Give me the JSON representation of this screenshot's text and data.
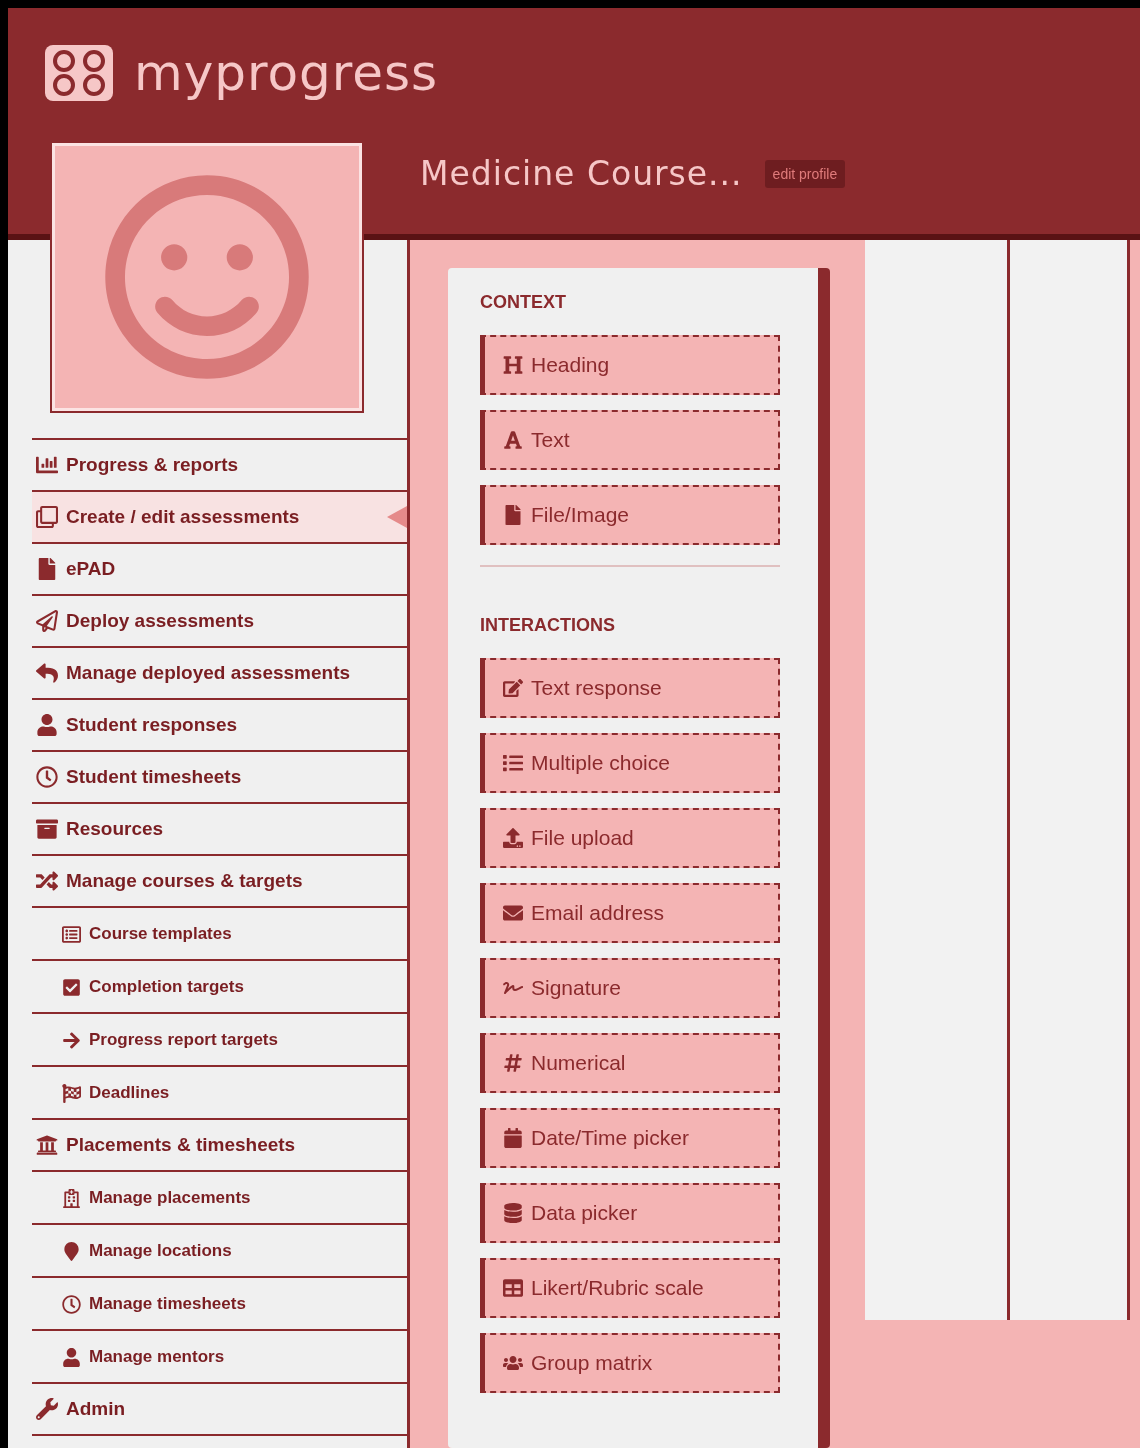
{
  "header": {
    "logo": "myprogress",
    "course_title": "Medicine Course...",
    "edit_button": "edit profile"
  },
  "sidebar": {
    "items": [
      {
        "label": "Progress & reports",
        "kind": "top",
        "selected": false
      },
      {
        "label": "Create / edit assessments",
        "kind": "top",
        "selected": true
      },
      {
        "label": "ePAD",
        "kind": "top",
        "selected": false
      },
      {
        "label": "Deploy assessments",
        "kind": "top",
        "selected": false
      },
      {
        "label": "Manage deployed assessments",
        "kind": "top",
        "selected": false
      },
      {
        "label": "Student responses",
        "kind": "top",
        "selected": false
      },
      {
        "label": "Student timesheets",
        "kind": "top",
        "selected": false
      },
      {
        "label": "Resources",
        "kind": "top",
        "selected": false
      },
      {
        "label": "Manage courses & targets",
        "kind": "top",
        "selected": false
      },
      {
        "label": "Course templates",
        "kind": "sub",
        "selected": false
      },
      {
        "label": "Completion targets",
        "kind": "sub",
        "selected": false
      },
      {
        "label": "Progress report targets",
        "kind": "sub",
        "selected": false
      },
      {
        "label": "Deadlines",
        "kind": "sub",
        "selected": false
      },
      {
        "label": "Placements & timesheets",
        "kind": "top",
        "selected": false
      },
      {
        "label": "Manage placements",
        "kind": "sub",
        "selected": false
      },
      {
        "label": "Manage locations",
        "kind": "sub",
        "selected": false
      },
      {
        "label": "Manage timesheets",
        "kind": "sub",
        "selected": false
      },
      {
        "label": "Manage mentors",
        "kind": "sub",
        "selected": false
      },
      {
        "label": "Admin",
        "kind": "top",
        "selected": false
      }
    ]
  },
  "toolbox": {
    "sections": [
      {
        "title": "CONTEXT",
        "items": [
          "Heading",
          "Text",
          "File/Image"
        ]
      },
      {
        "title": "INTERACTIONS",
        "items": [
          "Text response",
          "Multiple choice",
          "File upload",
          "Email address",
          "Signature",
          "Numerical",
          "Date/Time picker",
          "Data picker",
          "Likert/Rubric scale",
          "Group matrix"
        ]
      }
    ]
  }
}
